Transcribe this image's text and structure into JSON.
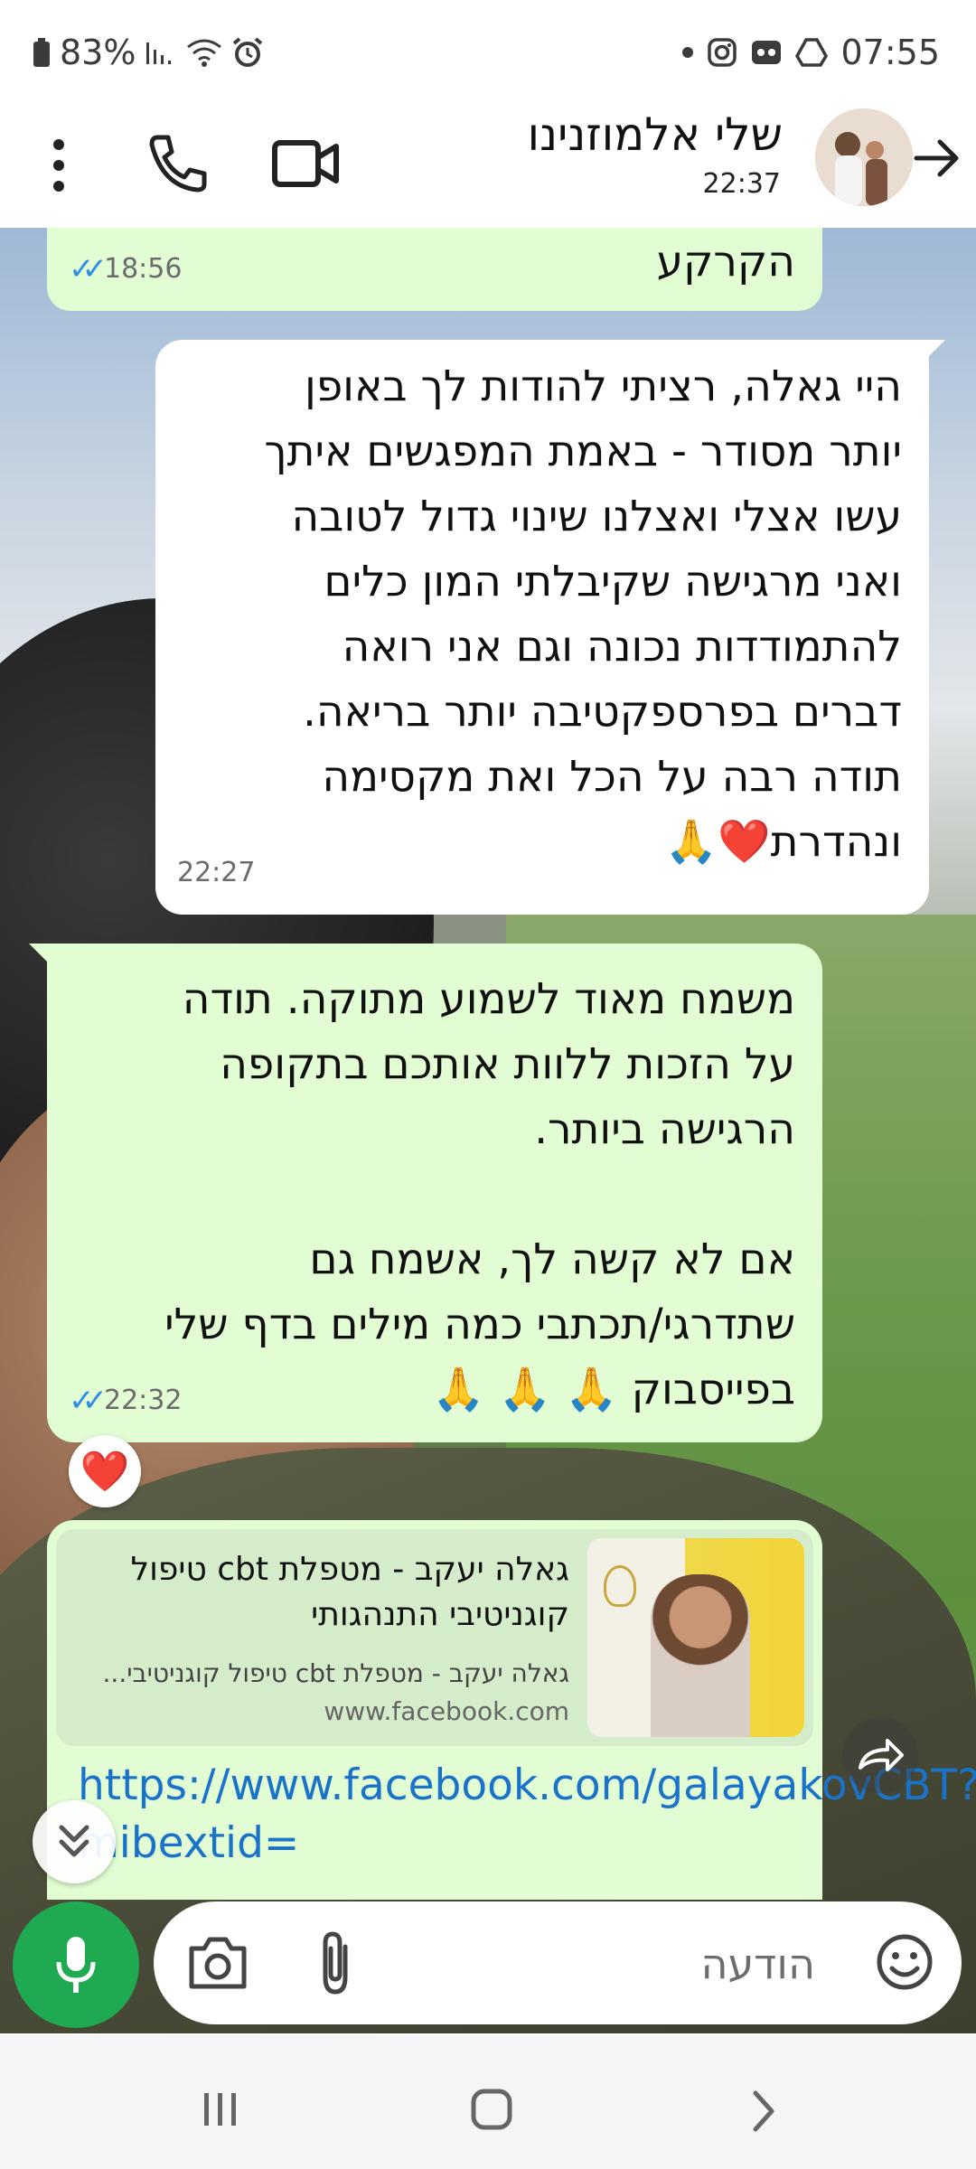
{
  "status_bar": {
    "battery": "83%",
    "time": "07:55",
    "icons": [
      "battery-icon",
      "signal-icon",
      "wifi-icon",
      "alarm-icon",
      "dot-icon",
      "instagram-icon",
      "voicemail-icon",
      "drive-icon"
    ]
  },
  "header": {
    "contact_name": "שלי אלמוזנינו",
    "last_seen": "22:37",
    "icons": [
      "more-vert-icon",
      "phone-icon",
      "video-icon",
      "arrow-forward-icon"
    ]
  },
  "messages": [
    {
      "id": "m1",
      "direction": "out",
      "text": "הקרקע",
      "time": "18:56",
      "read": true
    },
    {
      "id": "m2",
      "direction": "in",
      "text": "היי גאלה, רציתי להודות לך באופן\nיותר מסודר - באמת המפגשים איתך\nעשו אצלי ואצלנו שינוי גדול לטובה\nואני מרגישה שקיבלתי המון כלים\nלהתמודדות נכונה וגם אני רואה\nדברים בפרספקטיבה יותר בריאה.\nתודה רבה על הכל ואת  מקסימה\nונהדרת❤️🙏",
      "time": "22:27"
    },
    {
      "id": "m3",
      "direction": "out",
      "text": "משמח מאוד לשמוע מתוקה. תודה\nעל הזכות ללוות אותכם בתקופה\nהרגישה ביותר.\n\nאם לא קשה לך, אשמח גם\nשתדרגי/תכתבי כמה מילים בדף שלי\nבפייסבוק 🙏 🙏 🙏",
      "time": "22:32",
      "read": true,
      "reaction": "❤️"
    },
    {
      "id": "m4",
      "direction": "out",
      "link_preview": {
        "title": "גאלה יעקב - מטפלת cbt טיפול קוגניטיבי התנהגותי",
        "description": "גאלה יעקב - מטפלת cbt טיפול קוגניטיבי...",
        "domain": "www.facebook.com"
      },
      "url": "https://www.facebook.com/galayakovCBT?mibextid="
    }
  ],
  "composer": {
    "placeholder": "הודעה",
    "icons": [
      "mic-icon",
      "camera-icon",
      "attach-icon",
      "emoji-icon"
    ]
  },
  "floating": {
    "icons": [
      "forward-icon",
      "scroll-down-icon"
    ]
  },
  "nav_bar": {
    "icons": [
      "recents-icon",
      "home-icon",
      "back-icon"
    ]
  },
  "colors": {
    "outgoing_bubble": "#e2fdd4",
    "incoming_bubble": "#ffffff",
    "accent_green": "#1faa52",
    "read_ticks": "#2f8ee6",
    "link": "#1a73c9"
  }
}
